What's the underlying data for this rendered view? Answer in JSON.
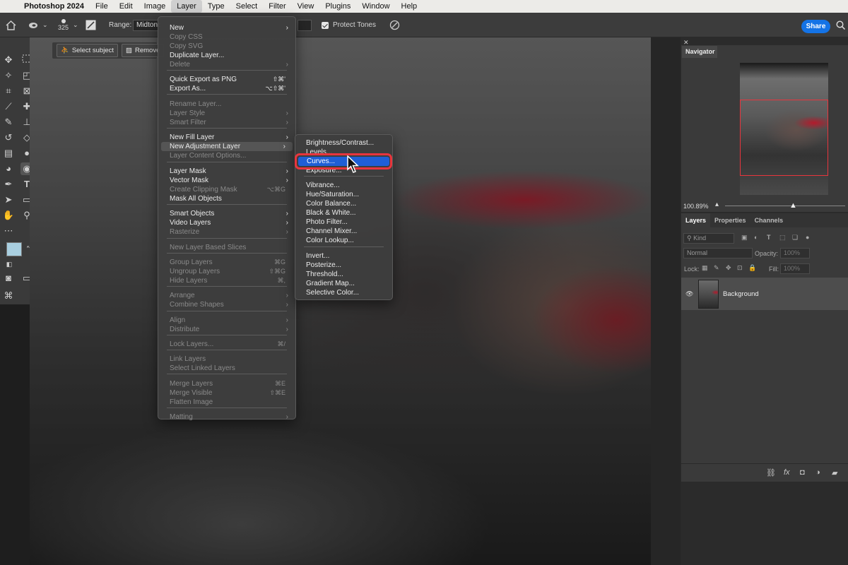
{
  "menubar": {
    "apple_icon": "apple-logo-icon",
    "app_name": "Photoshop 2024",
    "items": [
      "File",
      "Edit",
      "Image",
      "Layer",
      "Type",
      "Select",
      "Filter",
      "View",
      "Plugins",
      "Window",
      "Help"
    ],
    "active": "Layer"
  },
  "options_bar": {
    "brush_size": "325",
    "range_label": "Range:",
    "range_value": "Midtones",
    "protect_tones_label": "Protect Tones",
    "protect_tones_checked": true,
    "share_label": "Share"
  },
  "task_bar": {
    "select_subject_label": "Select subject",
    "remove_label": "Remove"
  },
  "layer_menu": {
    "items": [
      {
        "label": "New",
        "disabled": false,
        "shortcut": "",
        "submenu": true
      },
      {
        "label": "Copy CSS",
        "disabled": true,
        "shortcut": "",
        "submenu": false
      },
      {
        "label": "Copy SVG",
        "disabled": true,
        "shortcut": "",
        "submenu": false
      },
      {
        "label": "Duplicate Layer...",
        "disabled": false,
        "shortcut": "",
        "submenu": false
      },
      {
        "label": "Delete",
        "disabled": true,
        "shortcut": "",
        "submenu": true
      },
      {
        "label": "Quick Export as PNG",
        "disabled": false,
        "shortcut": "⇧⌘'",
        "submenu": false
      },
      {
        "label": "Export As...",
        "disabled": false,
        "shortcut": "⌥⇧⌘'",
        "submenu": false
      },
      {
        "label": "Rename Layer...",
        "disabled": true,
        "shortcut": "",
        "submenu": false
      },
      {
        "label": "Layer Style",
        "disabled": true,
        "shortcut": "",
        "submenu": true
      },
      {
        "label": "Smart Filter",
        "disabled": true,
        "shortcut": "",
        "submenu": true
      },
      {
        "label": "New Fill Layer",
        "disabled": false,
        "shortcut": "",
        "submenu": true
      },
      {
        "label": "New Adjustment Layer",
        "disabled": false,
        "shortcut": "",
        "submenu": true,
        "highlighted": true
      },
      {
        "label": "Layer Content Options...",
        "disabled": true,
        "shortcut": "",
        "submenu": false
      },
      {
        "label": "Layer Mask",
        "disabled": false,
        "shortcut": "",
        "submenu": true
      },
      {
        "label": "Vector Mask",
        "disabled": false,
        "shortcut": "",
        "submenu": true
      },
      {
        "label": "Create Clipping Mask",
        "disabled": true,
        "shortcut": "⌥⌘G",
        "submenu": false
      },
      {
        "label": "Mask All Objects",
        "disabled": false,
        "shortcut": "",
        "submenu": false
      },
      {
        "label": "Smart Objects",
        "disabled": false,
        "shortcut": "",
        "submenu": true
      },
      {
        "label": "Video Layers",
        "disabled": false,
        "shortcut": "",
        "submenu": true
      },
      {
        "label": "Rasterize",
        "disabled": true,
        "shortcut": "",
        "submenu": true
      },
      {
        "label": "New Layer Based Slices",
        "disabled": true,
        "shortcut": "",
        "submenu": false
      },
      {
        "label": "Group Layers",
        "disabled": true,
        "shortcut": "⌘G",
        "submenu": false
      },
      {
        "label": "Ungroup Layers",
        "disabled": true,
        "shortcut": "⇧⌘G",
        "submenu": false
      },
      {
        "label": "Hide Layers",
        "disabled": true,
        "shortcut": "⌘,",
        "submenu": false
      },
      {
        "label": "Arrange",
        "disabled": true,
        "shortcut": "",
        "submenu": true
      },
      {
        "label": "Combine Shapes",
        "disabled": true,
        "shortcut": "",
        "submenu": true
      },
      {
        "label": "Align",
        "disabled": true,
        "shortcut": "",
        "submenu": true
      },
      {
        "label": "Distribute",
        "disabled": true,
        "shortcut": "",
        "submenu": true
      },
      {
        "label": "Lock Layers...",
        "disabled": true,
        "shortcut": "⌘/",
        "submenu": false
      },
      {
        "label": "Link Layers",
        "disabled": true,
        "shortcut": "",
        "submenu": false
      },
      {
        "label": "Select Linked Layers",
        "disabled": true,
        "shortcut": "",
        "submenu": false
      },
      {
        "label": "Merge Layers",
        "disabled": true,
        "shortcut": "⌘E",
        "submenu": false
      },
      {
        "label": "Merge Visible",
        "disabled": true,
        "shortcut": "⇧⌘E",
        "submenu": false
      },
      {
        "label": "Flatten Image",
        "disabled": true,
        "shortcut": "",
        "submenu": false
      },
      {
        "label": "Matting",
        "disabled": true,
        "shortcut": "",
        "submenu": true
      }
    ]
  },
  "adjustment_submenu": {
    "items": [
      {
        "label": "Brightness/Contrast...",
        "highlighted": false
      },
      {
        "label": "Levels...",
        "highlighted": false
      },
      {
        "label": "Curves...",
        "highlighted": true
      },
      {
        "label": "Exposure...",
        "highlighted": false
      },
      {
        "label": "Vibrance...",
        "highlighted": false
      },
      {
        "label": "Hue/Saturation...",
        "highlighted": false
      },
      {
        "label": "Color Balance...",
        "highlighted": false
      },
      {
        "label": "Black & White...",
        "highlighted": false
      },
      {
        "label": "Photo Filter...",
        "highlighted": false
      },
      {
        "label": "Channel Mixer...",
        "highlighted": false
      },
      {
        "label": "Color Lookup...",
        "highlighted": false
      },
      {
        "label": "Invert...",
        "highlighted": false
      },
      {
        "label": "Posterize...",
        "highlighted": false
      },
      {
        "label": "Threshold...",
        "highlighted": false
      },
      {
        "label": "Gradient Map...",
        "highlighted": false
      },
      {
        "label": "Selective Color...",
        "highlighted": false
      }
    ],
    "highlight_color": "#1f5fd6",
    "annotation_ring_color": "#e8353d"
  },
  "navigator": {
    "title": "Navigator",
    "zoom": "100.89%",
    "view_box_color": "#e8353d"
  },
  "layers_panel": {
    "tabs": [
      "Layers",
      "Properties",
      "Channels"
    ],
    "active_tab": "Layers",
    "filter_placeholder": "Kind",
    "blend_mode": "Normal",
    "opacity_label": "Opacity:",
    "opacity_value": "100%",
    "lock_label": "Lock:",
    "fill_label": "Fill:",
    "fill_value": "100%",
    "layers": [
      {
        "name": "Background",
        "visible": true
      }
    ]
  },
  "colors": {
    "foreground": "#a9cfe0",
    "background": "#ffffff",
    "accent": "#1473e6"
  }
}
